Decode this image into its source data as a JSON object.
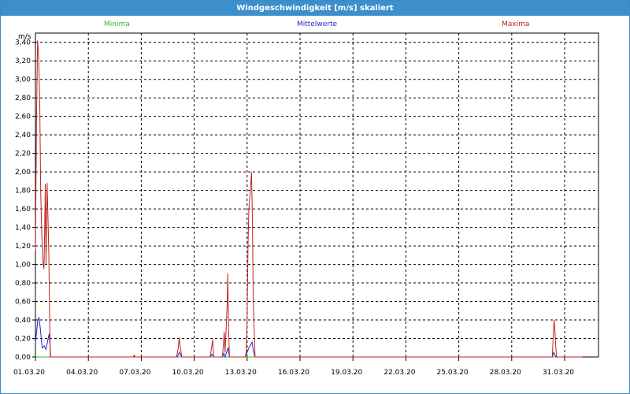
{
  "window": {
    "title": "Windgeschwindigkeit [m/s] skaliert"
  },
  "colors": {
    "title_bar": "#3c8fca",
    "minima": "#2fb82f",
    "mittelwerte": "#2424c8",
    "maxima": "#c02020",
    "grid": "#000000"
  },
  "chart_data": {
    "type": "line",
    "title": "Windgeschwindigkeit [m/s] skaliert",
    "ylabel": "m/s",
    "xlabel": "",
    "ylim": [
      0,
      3.5
    ],
    "xlim": [
      "01.03.20",
      "01.04.20"
    ],
    "grid": true,
    "legend_placement": "top",
    "y_ticks": [
      "0,00",
      "0,20",
      "0,40",
      "0,60",
      "0,80",
      "1,00",
      "1,20",
      "1,40",
      "1,60",
      "1,80",
      "2,00",
      "2,20",
      "2,40",
      "2,60",
      "2,80",
      "3,00",
      "3,20",
      "3,40"
    ],
    "x_ticks": [
      "01.03.20",
      "04.03.20",
      "07.03.20",
      "10.03.20",
      "13.03.20",
      "16.03.20",
      "19.03.20",
      "22.03.20",
      "25.03.20",
      "28.03.20",
      "31.03.20"
    ],
    "series": [
      {
        "name": "Minima",
        "color": "#2fb82f",
        "points": [
          [
            0.0,
            0.0
          ],
          [
            31.0,
            0.0
          ]
        ]
      },
      {
        "name": "Mittelwerte",
        "color": "#2424c8",
        "points": [
          [
            0.0,
            0.15
          ],
          [
            0.12,
            0.38
          ],
          [
            0.2,
            0.43
          ],
          [
            0.28,
            0.3
          ],
          [
            0.38,
            0.1
          ],
          [
            0.5,
            0.12
          ],
          [
            0.6,
            0.08
          ],
          [
            0.7,
            0.18
          ],
          [
            0.78,
            0.25
          ],
          [
            0.86,
            0.0
          ],
          [
            0.9,
            0.0
          ],
          [
            5.55,
            0.0
          ],
          [
            5.6,
            0.01
          ],
          [
            5.65,
            0.0
          ],
          [
            8.05,
            0.0
          ],
          [
            8.15,
            0.05
          ],
          [
            8.3,
            0.0
          ],
          [
            9.9,
            0.0
          ],
          [
            10.0,
            0.03
          ],
          [
            10.1,
            0.0
          ],
          [
            10.6,
            0.0
          ],
          [
            10.68,
            0.04
          ],
          [
            10.75,
            0.0
          ],
          [
            10.85,
            0.06
          ],
          [
            10.92,
            0.1
          ],
          [
            11.0,
            0.0
          ],
          [
            11.9,
            0.0
          ],
          [
            12.0,
            0.05
          ],
          [
            12.1,
            0.1
          ],
          [
            12.2,
            0.13
          ],
          [
            12.28,
            0.16
          ],
          [
            12.35,
            0.07
          ],
          [
            12.45,
            0.0
          ],
          [
            29.3,
            0.0
          ],
          [
            29.38,
            0.05
          ],
          [
            29.45,
            0.02
          ],
          [
            29.52,
            0.0
          ],
          [
            31.0,
            0.0
          ]
        ]
      },
      {
        "name": "Maxima",
        "color": "#c02020",
        "points": [
          [
            0.0,
            1.15
          ],
          [
            0.06,
            2.5
          ],
          [
            0.12,
            3.42
          ],
          [
            0.18,
            3.25
          ],
          [
            0.24,
            2.8
          ],
          [
            0.3,
            1.8
          ],
          [
            0.36,
            1.3
          ],
          [
            0.42,
            1.05
          ],
          [
            0.48,
            0.95
          ],
          [
            0.52,
            1.3
          ],
          [
            0.56,
            1.87
          ],
          [
            0.6,
            1.0
          ],
          [
            0.66,
            1.88
          ],
          [
            0.72,
            1.45
          ],
          [
            0.76,
            1.1
          ],
          [
            0.8,
            0.5
          ],
          [
            0.84,
            0.0
          ],
          [
            0.9,
            0.0
          ],
          [
            5.55,
            0.0
          ],
          [
            5.6,
            0.02
          ],
          [
            5.65,
            0.0
          ],
          [
            8.0,
            0.0
          ],
          [
            8.1,
            0.1
          ],
          [
            8.15,
            0.21
          ],
          [
            8.2,
            0.12
          ],
          [
            8.3,
            0.0
          ],
          [
            9.9,
            0.0
          ],
          [
            10.0,
            0.12
          ],
          [
            10.05,
            0.19
          ],
          [
            10.1,
            0.0
          ],
          [
            10.6,
            0.0
          ],
          [
            10.65,
            0.12
          ],
          [
            10.7,
            0.27
          ],
          [
            10.75,
            0.05
          ],
          [
            10.82,
            0.35
          ],
          [
            10.87,
            0.58
          ],
          [
            10.9,
            0.9
          ],
          [
            10.95,
            0.3
          ],
          [
            11.0,
            0.0
          ],
          [
            11.9,
            0.0
          ],
          [
            11.95,
            0.05
          ],
          [
            12.0,
            0.4
          ],
          [
            12.05,
            1.2
          ],
          [
            12.1,
            1.6
          ],
          [
            12.15,
            1.72
          ],
          [
            12.2,
            1.85
          ],
          [
            12.25,
            2.0
          ],
          [
            12.3,
            1.5
          ],
          [
            12.35,
            0.6
          ],
          [
            12.45,
            0.0
          ],
          [
            29.3,
            0.0
          ],
          [
            29.35,
            0.2
          ],
          [
            29.4,
            0.4
          ],
          [
            29.45,
            0.28
          ],
          [
            29.5,
            0.1
          ],
          [
            29.55,
            0.0
          ],
          [
            31.0,
            0.0
          ]
        ]
      }
    ]
  }
}
